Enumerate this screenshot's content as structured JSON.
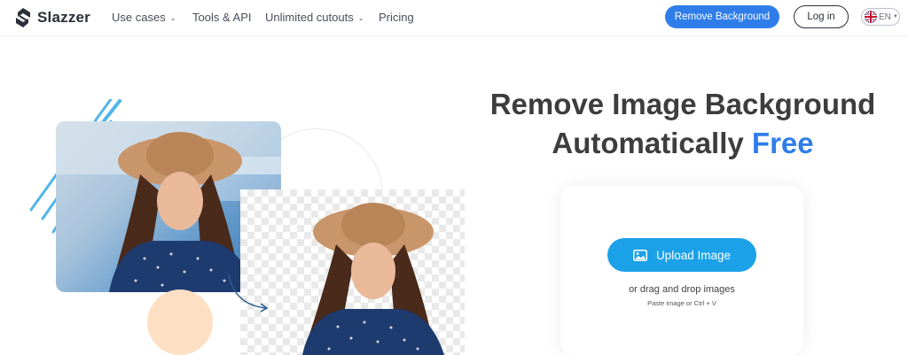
{
  "header": {
    "brand": "Slazzer",
    "nav": [
      {
        "label": "Use cases",
        "has_dropdown": true
      },
      {
        "label": "Tools & API",
        "has_dropdown": false
      },
      {
        "label": "Unlimited cutouts",
        "has_dropdown": true
      },
      {
        "label": "Pricing",
        "has_dropdown": false
      }
    ],
    "cta_label": "Remove Background",
    "login_label": "Log in",
    "language": "EN"
  },
  "hero": {
    "title_line1": "Remove Image Background",
    "title_line2": "Automatically",
    "title_highlight": "Free"
  },
  "upload": {
    "button_label": "Upload Image",
    "drag_text": "or drag and drop images",
    "paste_text": "Paste image or Ctrl + V"
  },
  "colors": {
    "primary": "#2f7de9",
    "upload_button": "#1aa1e8",
    "accent_peach": "#fde0c4",
    "title_text": "#3d3d3d"
  },
  "icons": [
    "slazzer-logo-icon",
    "chevron-down-icon",
    "uk-flag-icon",
    "image-icon",
    "curved-arrow-icon"
  ]
}
